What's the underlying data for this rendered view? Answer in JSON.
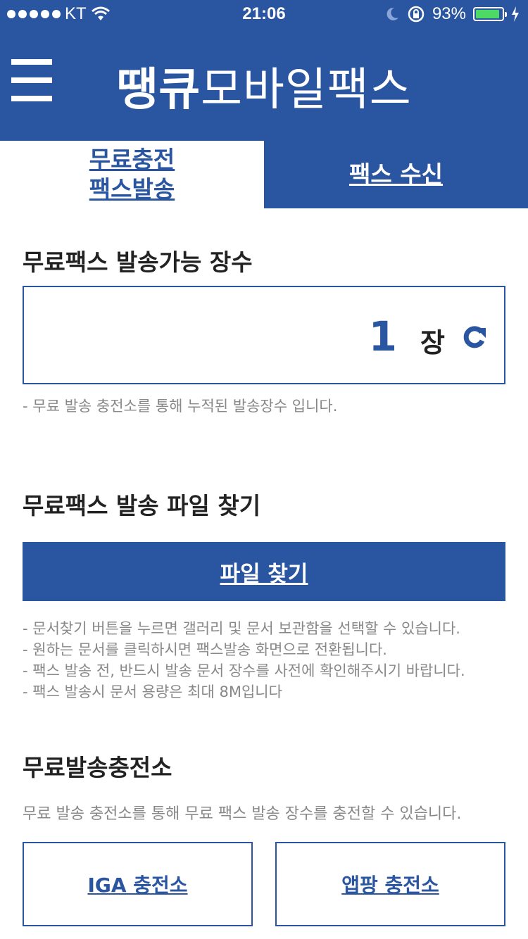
{
  "status_bar": {
    "carrier": "KT",
    "time": "21:06",
    "battery": "93%",
    "battery_level": 0.93,
    "icons": [
      "signal-dots",
      "wifi-icon",
      "moon-icon",
      "rotation-lock-icon",
      "battery-icon",
      "charging-icon"
    ]
  },
  "header": {
    "title_bold": "땡큐",
    "title_rest": "모바일팩스",
    "menu_icon": "hamburger-menu-icon"
  },
  "tabs": [
    {
      "line1": "무료충전",
      "line2": "팩스발송",
      "active": true
    },
    {
      "label": "팩스 수신",
      "active": false
    }
  ],
  "free_count": {
    "title": "무료팩스 발송가능 장수",
    "value": "1",
    "unit": "장",
    "note": "- 무료 발송 충전소를 통해 누적된 발송장수 입니다."
  },
  "file_search": {
    "title": "무료팩스 발송 파일 찾기",
    "button_label": "파일 찾기",
    "notes": [
      "- 문서찾기 버튼을 누르면 갤러리 및 문서 보관함을 선택할 수 있습니다.",
      "- 원하는 문서를 클릭하시면 팩스발송 화면으로 전환됩니다.",
      "- 팩스 발송 전, 반드시 발송 문서 장수를 사전에 확인해주시기 바랍니다.",
      "- 팩스 발송시 문서 용량은 최대 8M입니다"
    ]
  },
  "charging_station": {
    "title": "무료발송충전소",
    "description": "무료 발송 충전소를 통해 무료 팩스 발송 장수를 충전할 수 있습니다.",
    "buttons": [
      "IGA 충전소",
      "앱팡 충전소"
    ]
  },
  "colors": {
    "primary": "#2a55a0",
    "note_text": "#888888",
    "battery_green": "#4cd964"
  }
}
